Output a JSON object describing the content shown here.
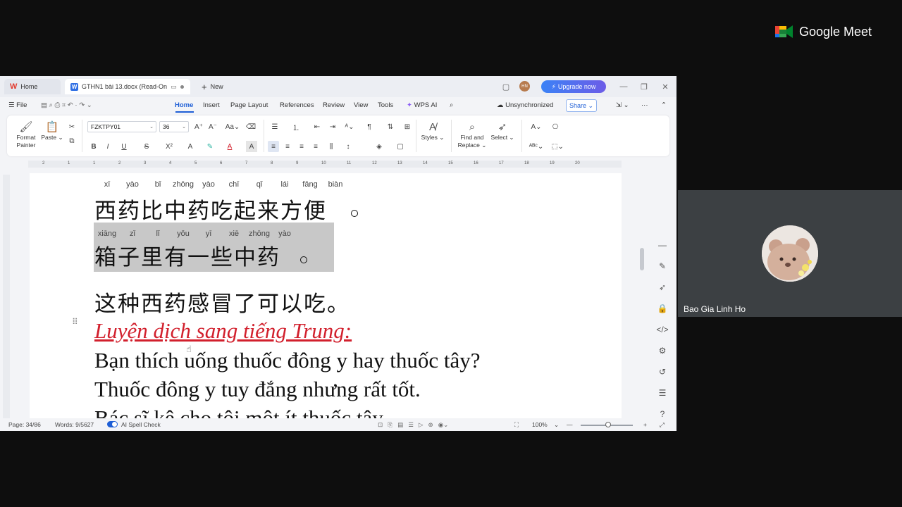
{
  "tabs": {
    "home": "Home",
    "doc": "GTHN1 bài 13.docx (Read-On",
    "new": "New"
  },
  "topbar": {
    "avatar_initials": "HN",
    "upgrade": "Upgrade now"
  },
  "menu": {
    "file": "File",
    "home": "Home",
    "insert": "Insert",
    "page_layout": "Page Layout",
    "references": "References",
    "review": "Review",
    "view": "View",
    "tools": "Tools",
    "wps_ai": "WPS AI",
    "sync": "Unsynchronized",
    "share": "Share"
  },
  "ribbon": {
    "format_painter_1": "Format",
    "format_painter_2": "Painter",
    "paste": "Paste",
    "font_name": "FZKTPY01",
    "font_size": "36",
    "styles": "Styles",
    "find_1": "Find and",
    "find_2": "Replace",
    "select": "Select"
  },
  "ruler_ticks": [
    "2",
    "1",
    "1",
    "2",
    "3",
    "4",
    "5",
    "6",
    "7",
    "8",
    "9",
    "10",
    "11",
    "12",
    "13",
    "14",
    "15",
    "16",
    "17",
    "18",
    "19",
    "20"
  ],
  "document": {
    "line1_pinyin": [
      "xī",
      "yào",
      "bǐ",
      "zhōng",
      "yào",
      "chī",
      "qǐ",
      "lái",
      "fāng",
      "biàn"
    ],
    "line1_hanzi": "西药比中药吃起来方便",
    "line2_pinyin": [
      "xiāng",
      "zǐ",
      "lǐ",
      "yǒu",
      "yī",
      "xiē",
      "zhōng",
      "yào"
    ],
    "line2_hanzi": "箱子里有一些中药",
    "line3_hanzi": "这种西药感冒了可以吃。",
    "heading": "Luyện dịch sang tiếng Trung:",
    "vi1": "Bạn thích uống thuốc đông y hay thuốc tây?",
    "vi2": "Thuốc đông y tuy đắng nhưng rất tốt.",
    "vi3": "Bác sĩ kê cho tôi một ít thuốc tây."
  },
  "status": {
    "page": "Page: 34/86",
    "words": "Words: 9/5627",
    "spell": "AI Spell Check",
    "zoom": "100%"
  },
  "meet": {
    "brand": "Google Meet",
    "participant": "Bao Gia Linh Ho"
  }
}
